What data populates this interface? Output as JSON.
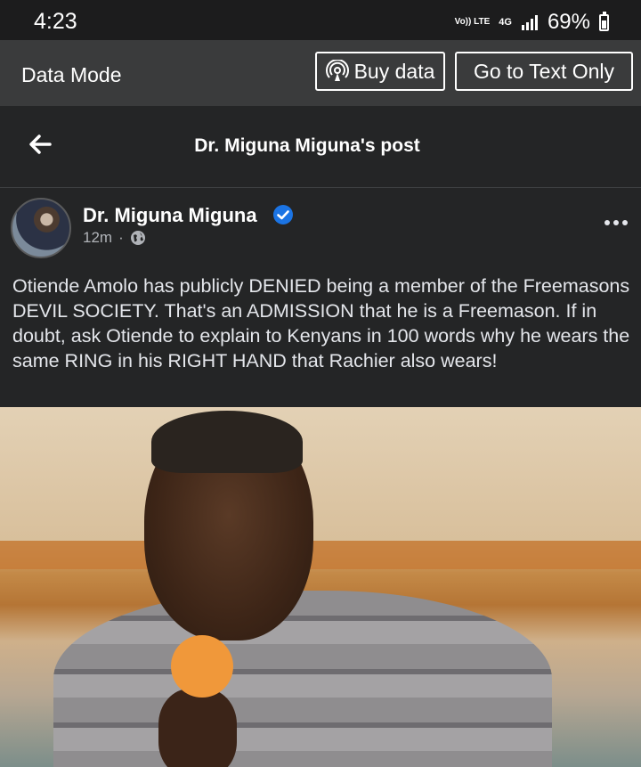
{
  "status_bar": {
    "time": "4:23",
    "volte": "Vo)) LTE",
    "network": "4G",
    "battery": "69%"
  },
  "data_bar": {
    "label": "Data Mode",
    "buy_data": "Buy data",
    "text_only": "Go to Text Only"
  },
  "nav": {
    "title": "Dr. Miguna Miguna's post"
  },
  "post": {
    "author": "Dr. Miguna Miguna",
    "time": "12m",
    "separator": "·",
    "text": "Otiende Amolo has publicly DENIED being a member of the Freemasons DEVIL SOCIETY. That's an ADMISSION that he is a Freemason. If in doubt, ask Otiende to explain to Kenyans in 100 words why he wears the same RING in his RIGHT HAND that Rachier also wears!"
  },
  "colors": {
    "background": "#242526",
    "verified": "#1b74e4"
  },
  "icons": [
    "back-arrow-icon",
    "verified-badge-icon",
    "globe-icon",
    "more-options-icon",
    "signal-icon",
    "battery-icon",
    "broadcast-icon"
  ]
}
